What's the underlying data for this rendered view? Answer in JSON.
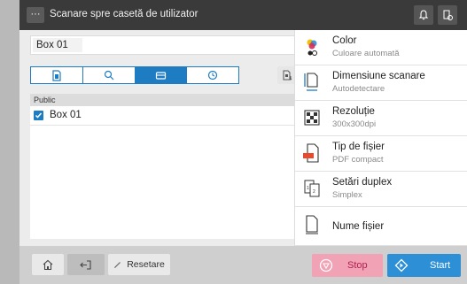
{
  "topbar": {
    "menu_label": "···",
    "title": "Scanare spre casetă de utilizator"
  },
  "box_field": {
    "value": "Box 01"
  },
  "tabs": [
    {
      "name": "tab-document",
      "icon": "document-icon",
      "active": false
    },
    {
      "name": "tab-search",
      "icon": "search-icon",
      "active": false
    },
    {
      "name": "tab-box",
      "icon": "box-icon",
      "active": true
    },
    {
      "name": "tab-history",
      "icon": "clock-icon",
      "active": false
    }
  ],
  "list": {
    "header": "Public",
    "items": [
      {
        "label": "Box 01",
        "checked": true
      }
    ]
  },
  "settings": [
    {
      "name": "color",
      "title": "Color",
      "subtitle": "Culoare automată",
      "icon": "color-icon"
    },
    {
      "name": "scan-size",
      "title": "Dimensiune scanare",
      "subtitle": "Autodetectare",
      "icon": "scan-size-icon"
    },
    {
      "name": "resolution",
      "title": "Rezoluție",
      "subtitle": "300x300dpi",
      "icon": "resolution-icon"
    },
    {
      "name": "file-type",
      "title": "Tip de fișier",
      "subtitle": "PDF compact",
      "icon": "pdf-file-icon"
    },
    {
      "name": "duplex",
      "title": "Setări duplex",
      "subtitle": "Simplex",
      "icon": "duplex-icon"
    },
    {
      "name": "file-name",
      "title": "Nume fișier",
      "subtitle": "",
      "icon": "file-icon"
    }
  ],
  "bottom": {
    "reset_label": "Resetare",
    "stop_label": "Stop",
    "start_label": "Start"
  },
  "colors": {
    "accent": "#1e7dc2",
    "start": "#2d8fd6",
    "stop": "#f2a2b5",
    "topbar": "#3a3a3a"
  }
}
